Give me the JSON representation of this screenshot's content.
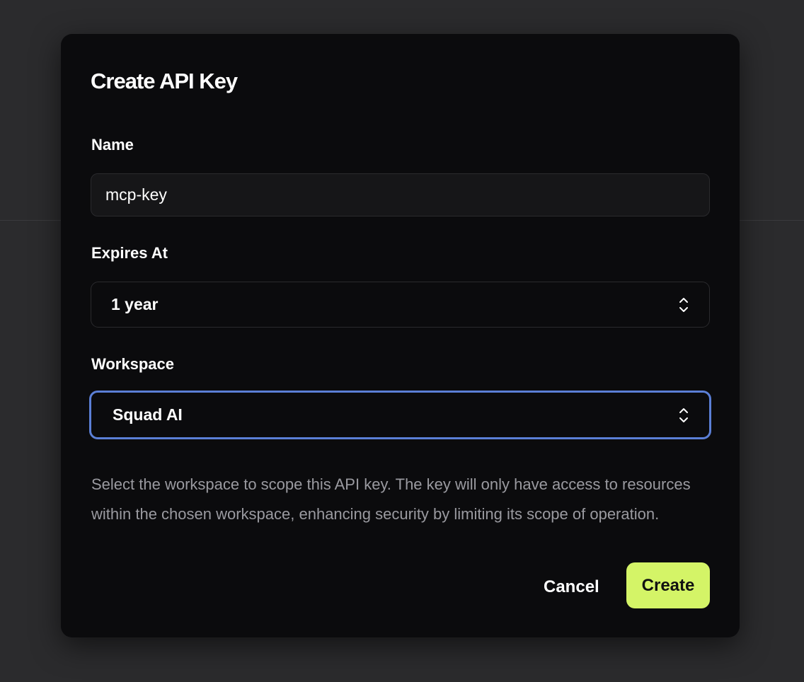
{
  "dialog": {
    "title": "Create API Key"
  },
  "form": {
    "name": {
      "label": "Name",
      "value": "mcp-key"
    },
    "expires_at": {
      "label": "Expires At",
      "selected": "1 year"
    },
    "workspace": {
      "label": "Workspace",
      "selected": "Squad AI",
      "help_text": "Select the workspace to scope this API key. The key will only have access to resources within the chosen workspace, enhancing security by limiting its scope of operation."
    }
  },
  "actions": {
    "cancel_label": "Cancel",
    "create_label": "Create"
  },
  "icons": {
    "select_indicator": "chevron-up-down-icon"
  },
  "colors": {
    "accent": "#d4f467",
    "focus_ring": "#5b7fd6",
    "modal_bg": "#0b0b0d",
    "backdrop": "#2b2b2d"
  }
}
